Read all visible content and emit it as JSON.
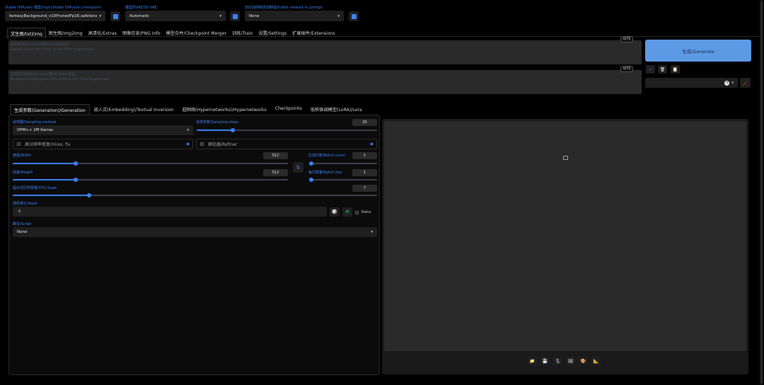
{
  "top": {
    "checkpoint_label": "Stable Diffusion 模型(ckpt)/Stable Diffusion checkpoint",
    "checkpoint_value": "fantasyBackground_v10PrunedFp16.safetensors",
    "vae_label": "模型的VAE/SD VAE",
    "vae_value": "Automatic",
    "network_label": "自动加网络添加到提示/Add network to prompt",
    "network_value": "None"
  },
  "main_tabs": [
    "文生图/txt2img",
    "图生图/img2img",
    "高清化/Extras",
    "图像信息/PNG Info",
    "模型合并/Checkpoint Merger",
    "训练/Train",
    "设置/Settings",
    "扩展插件/Extensions"
  ],
  "prompt": {
    "placeholder_line1": "提示词(按Ctrl+Enter或Alt+Enter生成)",
    "placeholder_line2": "Prompt (press Ctrl+Enter or Alt+Enter to generate)",
    "counter": "0/75"
  },
  "negative": {
    "placeholder_line1": "反向提示词(按Ctrl+Enter或Alt+Enter生成)",
    "placeholder_line2": "Negative prompt (press Ctrl+Enter or Alt+Enter to generate)",
    "counter": "0/75"
  },
  "generate_label": "生成/Generate",
  "sub_tabs": [
    "生成参数(Generation)/Generation",
    "嵌入式(Embedding)/Textual Inversion",
    "超网络(Hypernetworks)/Hypernetworks",
    "Checkpoints",
    "低秩微调模型(LoRA)/Lora"
  ],
  "generation": {
    "sampling_method_label": "采样器/Sampling method",
    "sampling_method_value": "DPM++ 2M Karras",
    "sampling_steps_label": "采样步数/Sampling steps",
    "sampling_steps_value": "20",
    "sampling_steps_fraction": 0.2,
    "hires_label": "高分辨率修复/Hires. fix",
    "refiner_label": "细化器/Refiner",
    "width_label": "宽度/Width",
    "width_value": "512",
    "width_fraction": 0.23,
    "height_label": "高度/Height",
    "height_value": "512",
    "height_fraction": 0.23,
    "batch_count_label": "生成次数/Batch count",
    "batch_count_value": "1",
    "batch_size_label": "每次数量/Batch size",
    "batch_size_value": "1",
    "cfg_label": "提示词引导系数/CFG Scale",
    "cfg_value": "7",
    "cfg_fraction": 0.21,
    "seed_label": "随机种子/Seed",
    "seed_value": "-1",
    "extra_label": "Extra",
    "script_label": "脚本/Script",
    "script_value": "None"
  },
  "icons": [
    "refresh-icon",
    "check-icon",
    "trash-icon",
    "clipboard-icon",
    "brush-icon",
    "dice-icon",
    "recycle-icon",
    "swap-icon",
    "folder-icon",
    "save-icon",
    "zip-icon",
    "image-icon",
    "palette-icon",
    "ruler-icon"
  ],
  "colors": {
    "accent": "#3b82f6",
    "generate": "#5d9ae6",
    "background": "#000000"
  }
}
